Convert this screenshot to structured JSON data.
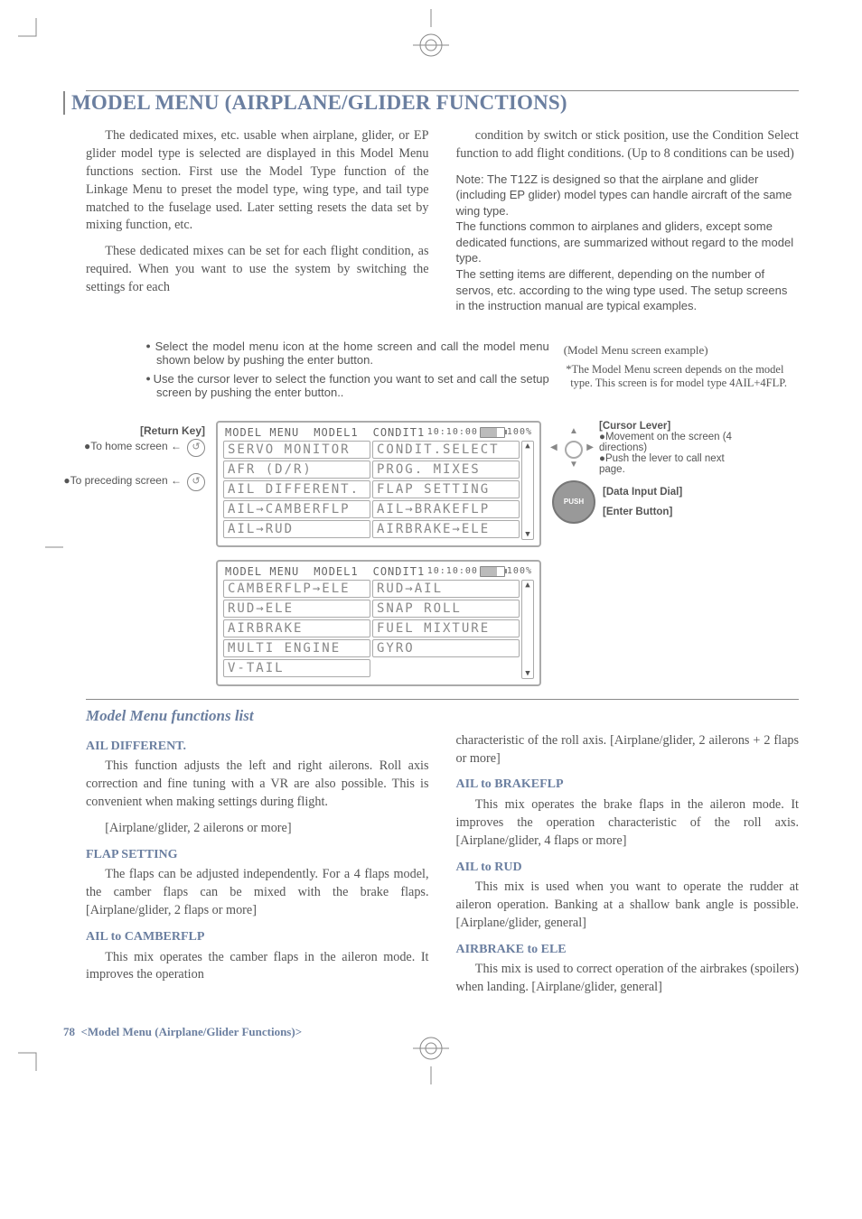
{
  "title": "MODEL MENU (AIRPLANE/GLIDER FUNCTIONS)",
  "intro": {
    "p1": "The dedicated mixes, etc. usable when airplane, glider, or EP glider model type is selected are displayed in this Model Menu functions section. First use the Model Type function of the Linkage Menu to preset the model type, wing type, and tail type matched to the fuselage used. Later setting resets the data set by mixing function, etc.",
    "p2": "These dedicated mixes can be set for each flight condition, as required. When you want to use the system by switching the settings for each",
    "p3": "condition by switch or stick position, use the Condition Select function to add flight conditions. (Up to 8 conditions can be used)",
    "note1": "Note: The T12Z is designed so that the airplane and glider (including EP glider) model types can handle aircraft of the same wing type.",
    "note2": "The functions common to airplanes and gliders, except some dedicated functions, are summarized without regard to the model type.",
    "note3": "The setting items are different, depending on the number of servos, etc. according to the wing type used. The setup screens in the instruction manual are typical examples."
  },
  "instructions": {
    "b1": "Select the model menu icon at the home screen and call the model menu shown below by pushing the enter button.",
    "b2": "Use the cursor lever to select the function you want to set and call the setup screen by pushing the enter button..",
    "example_label": "(Model Menu screen example)",
    "depends": "*The Model Menu screen depends on the model type. This screen is for model type 4AIL+4FLP."
  },
  "controls": {
    "return_key": "[Return Key]",
    "to_home": "To home screen",
    "to_prev": "To preceding screen",
    "cursor_lever": "[Cursor Lever]",
    "cursor_desc1": "Movement on the screen (4 directions)",
    "cursor_desc2": "Push the lever to call next page.",
    "data_dial": "[Data Input Dial]",
    "enter_btn": "[Enter Button]",
    "push": "PUSH"
  },
  "lcd1": {
    "header_left": "MODEL MENU",
    "header_mid": "MODEL1",
    "header_cond": "CONDIT1",
    "header_time": "10:10:00",
    "header_pct": "100%",
    "cells": [
      "SERVO MONITOR",
      "CONDIT.SELECT",
      "AFR (D/R)",
      "PROG. MIXES",
      "AIL DIFFERENT.",
      "FLAP SETTING",
      "AIL→CAMBERFLP",
      "AIL→BRAKEFLP",
      "AIL→RUD",
      "AIRBRAKE→ELE"
    ]
  },
  "lcd2": {
    "header_left": "MODEL MENU",
    "header_mid": "MODEL1",
    "header_cond": "CONDIT1",
    "header_time": "10:10:00",
    "header_pct": "100%",
    "cells": [
      "CAMBERFLP→ELE",
      "RUD→AIL",
      "RUD→ELE",
      "SNAP ROLL",
      "AIRBRAKE",
      "FUEL MIXTURE",
      "MULTI ENGINE",
      "GYRO",
      "V-TAIL",
      ""
    ]
  },
  "functions": {
    "title": "Model Menu functions list",
    "ail_diff_h": "AIL DIFFERENT.",
    "ail_diff_p1": "This function adjusts the left and right ailerons. Roll axis correction and fine tuning with a VR are also possible. This is convenient when making settings during flight.",
    "ail_diff_p2": "[Airplane/glider, 2 ailerons or more]",
    "flap_h": "FLAP SETTING",
    "flap_p": "The flaps can be adjusted independently. For a 4 flaps model, the camber flaps can be mixed with the brake flaps. [Airplane/glider, 2 flaps or more]",
    "ail_camber_h": "AIL to CAMBERFLP",
    "ail_camber_p": "This mix operates the camber flaps in the aileron mode. It improves the operation",
    "ail_camber_cont": "characteristic of the roll axis. [Airplane/glider, 2 ailerons + 2 flaps or more]",
    "ail_brake_h": "AIL to BRAKEFLP",
    "ail_brake_p": "This mix operates the brake flaps in the aileron mode. It improves the operation characteristic of the roll axis. [Airplane/glider, 4 flaps or more]",
    "ail_rud_h": "AIL to RUD",
    "ail_rud_p": "This mix is used when you want to operate the rudder at aileron operation. Banking at a shallow bank angle is possible. [Airplane/glider, general]",
    "airbrake_h": "AIRBRAKE to ELE",
    "airbrake_p": "This mix is used to correct operation of the airbrakes (spoilers) when landing. [Airplane/glider, general]"
  },
  "footer": {
    "page": "78",
    "label": "<Model Menu (Airplane/Glider Functions)>"
  }
}
